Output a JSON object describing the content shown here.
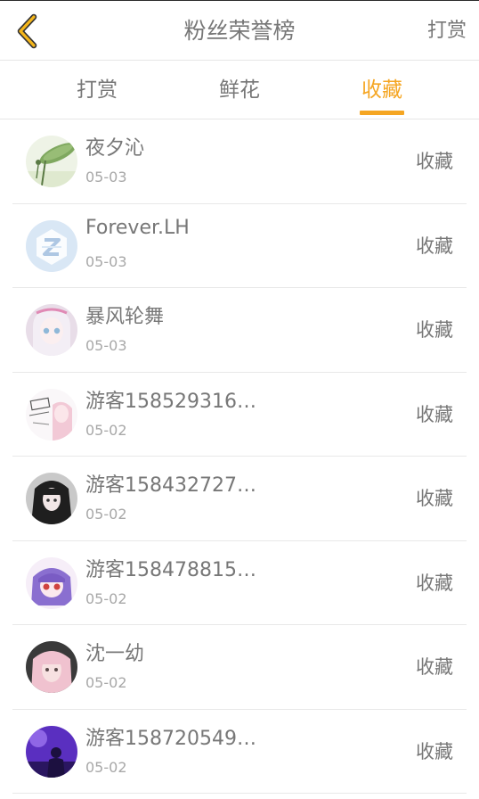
{
  "header": {
    "title": "粉丝荣誉榜",
    "right_link": "打赏",
    "back_icon": "chevron-left-icon",
    "accent_color": "#f5a623"
  },
  "tabs": [
    {
      "label": "打赏",
      "active": false
    },
    {
      "label": "鲜花",
      "active": false
    },
    {
      "label": "收藏",
      "active": true
    }
  ],
  "fans": [
    {
      "name": "夜夕沁",
      "date": "05-03",
      "action": "收藏",
      "avatar": "lotus-leaf-avatar"
    },
    {
      "name": "Forever.LH",
      "date": "05-03",
      "action": "收藏",
      "avatar": "default-z-avatar"
    },
    {
      "name": "暴风轮舞",
      "date": "05-03",
      "action": "收藏",
      "avatar": "anime-girl-avatar"
    },
    {
      "name": "游客158529316…",
      "date": "05-02",
      "action": "收藏",
      "avatar": "sketch-girl-avatar"
    },
    {
      "name": "游客158432727…",
      "date": "05-02",
      "action": "收藏",
      "avatar": "dark-hair-girl-avatar"
    },
    {
      "name": "游客158478815…",
      "date": "05-02",
      "action": "收藏",
      "avatar": "purple-hair-girl-avatar"
    },
    {
      "name": "沈一幼",
      "date": "05-02",
      "action": "收藏",
      "avatar": "pink-hair-girl-avatar"
    },
    {
      "name": "游客158720549…",
      "date": "05-02",
      "action": "收藏",
      "avatar": "purple-stage-avatar"
    }
  ]
}
